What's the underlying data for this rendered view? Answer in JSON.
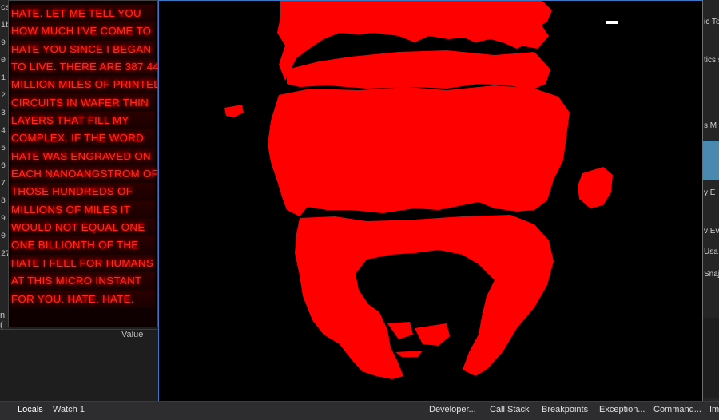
{
  "hate_text": {
    "lines": [
      "HATE.  LET ME TELL YOU",
      "HOW MUCH I'VE COME TO",
      "HATE YOU SINCE I BEGAN",
      "TO LIVE. THERE ARE 387.44",
      "MILLION MILES OF PRINTED",
      "CIRCUITS IN WAFER THIN",
      "LAYERS THAT FILL MY",
      "COMPLEX. IF THE WORD",
      "HATE WAS ENGRAVED ON",
      "EACH NANOANGSTROM OF",
      "THOSE HUNDREDS OF",
      "MILLIONS OF MILES IT",
      "WOULD NOT EQUAL ONE",
      "ONE BILLIONTH OF THE",
      "HATE I FEEL FOR HUMANS",
      "AT THIS MICRO INSTANT",
      "FOR YOU.  HATE. HATE."
    ]
  },
  "left_ide": {
    "fragments": [
      "cs",
      "ib",
      "9",
      "0",
      "1",
      "2",
      "3",
      "4",
      "5",
      "6",
      "7",
      "8",
      "9",
      "0",
      "27"
    ],
    "value_header": "Value",
    "row_fragment": "n ("
  },
  "right_ide": {
    "fragments": [
      "ic To",
      "tics s",
      "s M",
      "y  E",
      "v Eve",
      "Usa",
      "Snaj"
    ]
  },
  "bottom_tabs": {
    "left": [
      "Locals",
      "Watch 1"
    ],
    "right": [
      "Developer...",
      "Call Stack",
      "Breakpoints",
      "Exception...",
      "Command...",
      "Im"
    ]
  },
  "colors": {
    "blob": "#ff0000",
    "text_glow": "#ff2a1a",
    "window_border": "#3b78c8"
  }
}
